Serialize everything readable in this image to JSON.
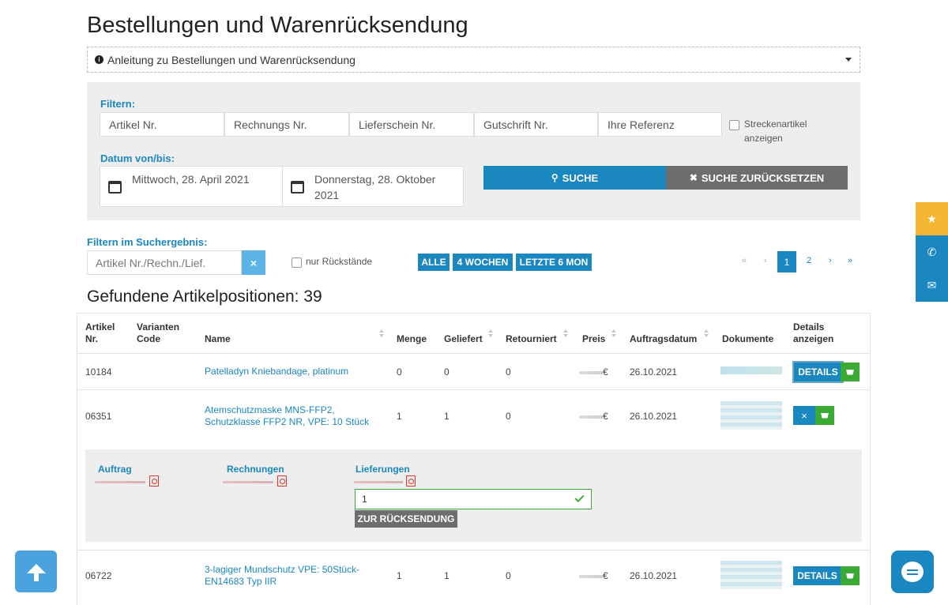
{
  "page": {
    "title": "Bestellungen und Warenrücksendung",
    "guide_label": "Anleitung zu Bestellungen und Warenrücksendung"
  },
  "filter": {
    "label": "Filtern:",
    "fields": [
      {
        "placeholder": "Artikel Nr."
      },
      {
        "placeholder": "Rechnungs Nr."
      },
      {
        "placeholder": "Lieferschein Nr."
      },
      {
        "placeholder": "Gutschrift Nr."
      },
      {
        "placeholder": "Ihre Referenz"
      }
    ],
    "checkbox_label_1": "Streckenartikel",
    "checkbox_label_2": "anzeigen",
    "date_label": "Datum von/bis:",
    "date_from": "Mittwoch, 28. April 2021",
    "date_to_1": "Donnerstag, 28. Oktober",
    "date_to_2": "2021",
    "search_label": "SUCHE",
    "reset_label": "SUCHE ZURÜCKSETZEN"
  },
  "result_filter": {
    "label": "Filtern im Suchergebnis:",
    "placeholder": "Artikel Nr./Rechn./Lief.",
    "clear": "×",
    "backorder_label": "nur Rückstände",
    "periods": [
      "ALLE",
      "4 WOCHEN",
      "LETZTE 6 MON"
    ]
  },
  "pagination": {
    "first": "«",
    "prev": "‹",
    "pages": [
      "1",
      "2"
    ],
    "next": "›",
    "last": "»",
    "active_page": "1"
  },
  "results": {
    "heading": "Gefundene Artikelpositionen: 39"
  },
  "table": {
    "headers": {
      "artikel_1": "Artikel",
      "artikel_2": "Nr.",
      "varianten_1": "Varianten",
      "varianten_2": "Code",
      "name": "Name",
      "menge": "Menge",
      "geliefert": "Geliefert",
      "retourniert": "Retourniert",
      "preis": "Preis",
      "auftragsdatum": "Auftragsdatum",
      "dokumente": "Dokumente",
      "details_1": "Details",
      "details_2": "anzeigen"
    },
    "rows": [
      {
        "nr": "10184",
        "name_1": "Patelladyn Kniebandage, platinum",
        "name_2": "",
        "menge": "0",
        "geliefert": "0",
        "retourniert": "0",
        "preis_suffix": "€",
        "datum": "26.10.2021",
        "details": "DETAILS"
      },
      {
        "nr": "06351",
        "name_1": "Atemschutzmaske MNS-FFP2,",
        "name_2": "Schutzklasse FFP2 NR, VPE: 10 Stück",
        "menge": "1",
        "geliefert": "1",
        "retourniert": "0",
        "preis_suffix": "€",
        "datum": "26.10.2021",
        "details": "×"
      },
      {
        "nr": "06722",
        "name_1": "3-lagiger Mundschutz VPE: 50Stück-",
        "name_2": "EN14683 Typ IIR",
        "menge": "1",
        "geliefert": "1",
        "retourniert": "0",
        "preis_suffix": "€",
        "datum": "26.10.2021",
        "details": "DETAILS"
      }
    ]
  },
  "detail_panel": {
    "auftrag": "Auftrag",
    "rechnungen": "Rechnungen",
    "lieferungen": "Lieferungen",
    "qty_value": "1",
    "return_button": "ZUR RÜCKSENDUNG"
  },
  "colors": {
    "accent": "#1a87c0",
    "green": "#3aaa35",
    "grey_button": "#6d6d6d",
    "side_star": "#f5b731"
  },
  "icons": {
    "side": [
      "star-icon",
      "phone-icon",
      "mail-icon"
    ],
    "scroll_top": "arrow-up-icon",
    "chat": "chat-icon"
  }
}
